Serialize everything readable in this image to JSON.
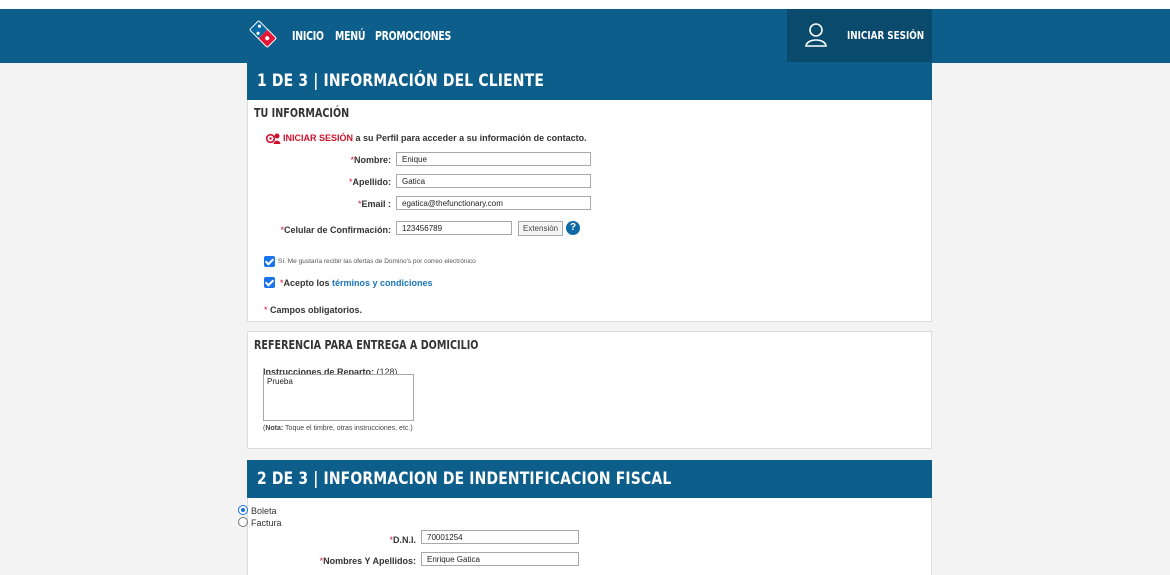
{
  "nav": {
    "items": [
      "INICIO",
      "MENÚ",
      "PROMOCIONES"
    ],
    "login_label": "INICIAR SESIÓN"
  },
  "section1": {
    "title": "1 DE 3 | INFORMACIÓN DEL CLIENTE",
    "subtitle": "TU INFORMACIÓN",
    "login_link": "INICIAR SESIÓN",
    "login_text": " a su Perfil para acceder a su información de contacto.",
    "fields": {
      "nombre_label": "Nombre:",
      "nombre_value": "Enique",
      "apellido_label": "Apellido:",
      "apellido_value": "Gatica",
      "email_label": "Email :",
      "email_value": "egatica@thefunctionary.com",
      "celular_label": "Celular de Confirmación:",
      "celular_value": "123456789",
      "extension_label": "Extensión"
    },
    "offers_text": "Sí. Me gustaría recibir las ofertas de Domino's por correo electrónico",
    "terms_prefix": "Acepto los ",
    "terms_link": "términos y condiciones",
    "required_note": "Campos obligatorios."
  },
  "delivery": {
    "title": "REFERENCIA PARA ENTREGA A DOMICILIO",
    "instructions_label": "Instrucciones de Reparto:",
    "char_count": "(128)",
    "instructions_value": "Prueba",
    "note_bold": "Nota:",
    "note_text": " Toque el timbre, otras instrucciones, etc.)"
  },
  "section2": {
    "title": "2 DE 3 | INFORMACION DE INDENTIFICACION FISCAL",
    "options": [
      "Boleta",
      "Factura"
    ],
    "dni_label": "D.N.I.",
    "dni_value": "70001254",
    "names_label": "Nombres Y Apellidos:",
    "names_value": "Enrique Gatica"
  },
  "colors": {
    "brand_blue": "#0d5e8a",
    "required_red": "#d0102c",
    "link_blue": "#1a75b7"
  }
}
